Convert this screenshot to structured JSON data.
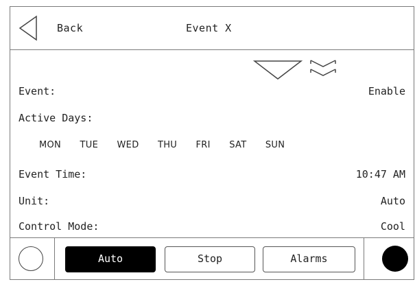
{
  "header": {
    "back_label": "Back",
    "title": "Event X"
  },
  "icons": {
    "back": "back-triangle-icon",
    "scroll_down": "down-triangle-icon",
    "scroll_bottom": "double-chevron-down-icon",
    "left_circle": "empty-circle-icon",
    "right_circle": "filled-circle-icon"
  },
  "settings": {
    "event": {
      "label": "Event:",
      "value": "Enable"
    },
    "active_days": {
      "label": "Active Days:",
      "days": [
        "MON",
        "TUE",
        "WED",
        "THU",
        "FRI",
        "SAT",
        "SUN"
      ]
    },
    "event_time": {
      "label": "Event Time:",
      "value": "10:47 AM"
    },
    "unit": {
      "label": "Unit:",
      "value": "Auto"
    },
    "control_mode": {
      "label": "Control Mode:",
      "value": "Cool"
    }
  },
  "footer": {
    "auto_label": "Auto",
    "stop_label": "Stop",
    "alarms_label": "Alarms",
    "selected": "Auto"
  }
}
